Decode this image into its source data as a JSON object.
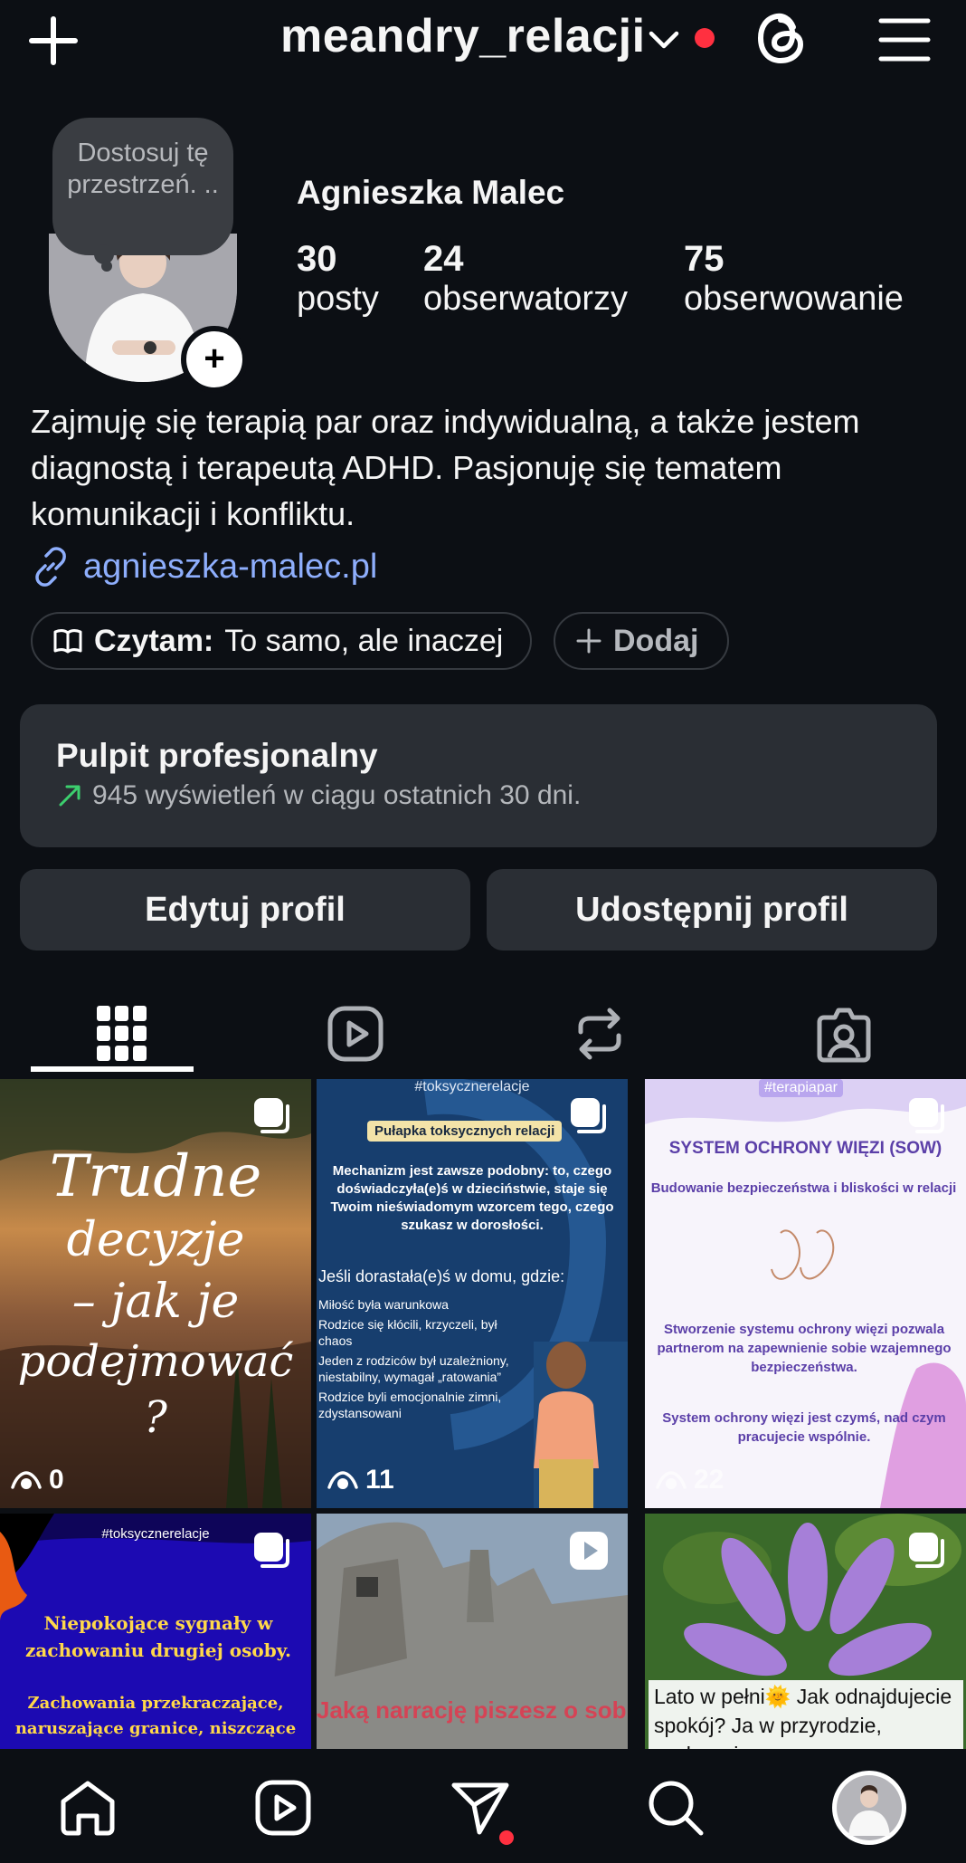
{
  "header": {
    "username": "meandry_relacji",
    "icons": [
      "plus-icon",
      "chevron-down-icon",
      "threads-icon",
      "hamburger-menu-icon"
    ],
    "notification_color": "#ff3040"
  },
  "profile": {
    "note": "Dostosuj tę przestrzeń. ..",
    "name": "Agnieszka Malec",
    "stats": [
      {
        "value": "30",
        "label": "posty"
      },
      {
        "value": "24",
        "label": "obserwatorzy"
      },
      {
        "value": "75",
        "label": "obserwowanie"
      }
    ],
    "bio": "Zajmuję się terapią par oraz indywidualną, a także jestem diagnostą i terapeutą ADHD. Pasjonuję się tematem komunikacji i konfliktu.",
    "link": "agnieszka-malec.pl",
    "reading_label": "Czytam:",
    "reading_title": "To samo, ale inaczej",
    "add_label": "Dodaj"
  },
  "dashboard": {
    "title": "Pulpit profesjonalny",
    "subtitle": "945 wyświetleń w ciągu ostatnich 30 dni.",
    "trend_color": "#3ccf6e"
  },
  "actions": {
    "edit": "Edytuj profil",
    "share": "Udostępnij profil"
  },
  "tabs": [
    "grid-icon",
    "reels-icon",
    "reposts-icon",
    "tagged-icon"
  ],
  "posts": [
    {
      "type": "carousel",
      "views": "0",
      "lines": [
        "Trudne",
        "decyzje",
        "– jak je",
        "podejmować",
        "?"
      ]
    },
    {
      "type": "carousel",
      "views": "11",
      "hashtag": "#toksycznerelacje",
      "title": "Pułapka toksycznych relacji",
      "body": "Mechanizm jest zawsze podobny: to, czego doświadczyła(e)ś w dzieciństwie, staje się Twoim nieświadomym wzorcem tego, czego szukasz w dorosłości.",
      "list_title": "Jeśli dorastała(e)ś w domu, gdzie:",
      "list": [
        "Miłość była warunkowa",
        "Rodzice się kłócili, krzyczeli, był chaos",
        "Jeden z rodziców był uzależniony, niestabilny, wymagał „ratowania”",
        "Rodzice byli emocjonalnie zimni, zdystansowani"
      ]
    },
    {
      "type": "carousel",
      "views": "22",
      "hashtag": "#terapiapar",
      "title": "SYSTEM OCHRONY WIĘZI (SOW)",
      "subtitle": "Budowanie bezpieczeństwa i bliskości w relacji",
      "body1": "Stworzenie systemu ochrony więzi pozwala partnerom na zapewnienie sobie wzajemnego bezpieczeństwa.",
      "body2": "System ochrony więzi jest czymś, nad czym pracujecie wspólnie."
    },
    {
      "type": "carousel",
      "hashtag": "#toksycznerelacje",
      "title": "Niepokojące sygnały w zachowaniu drugiej osoby.",
      "body": "Zachowania przekraczające, naruszające granice, niszczące"
    },
    {
      "type": "reel",
      "caption": "Jaką narrację piszesz o sobie?"
    },
    {
      "type": "carousel",
      "caption": "Lato w pełni🌞 Jak odnajdujecie spokój? Ja w przyrodzie, zachwycie"
    }
  ],
  "bottom_nav": [
    "home-icon",
    "reels-icon",
    "direct-messages-icon",
    "search-icon",
    "profile-avatar"
  ]
}
